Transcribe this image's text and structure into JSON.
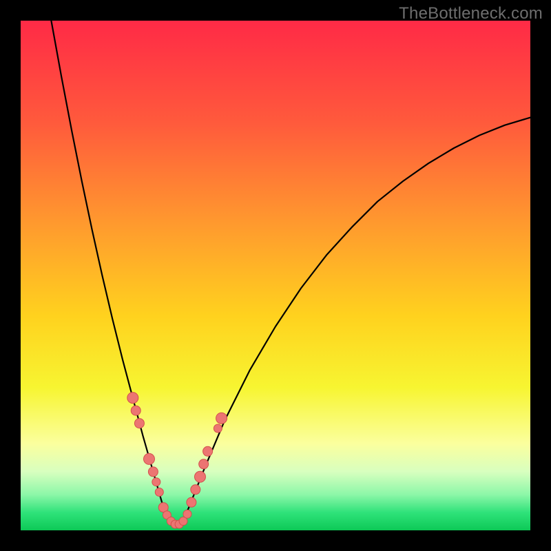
{
  "watermark": "TheBottleneck.com",
  "colors": {
    "frame": "#000000",
    "watermark_text": "#6e6e6e",
    "curve_stroke": "#000000",
    "dot_fill": "#ec7572",
    "dot_stroke": "#d34f4c",
    "gradient_stops": [
      {
        "offset": 0.0,
        "color": "#ff2a46"
      },
      {
        "offset": 0.2,
        "color": "#ff5a3c"
      },
      {
        "offset": 0.4,
        "color": "#ff9a2e"
      },
      {
        "offset": 0.58,
        "color": "#ffd21e"
      },
      {
        "offset": 0.72,
        "color": "#f7f531"
      },
      {
        "offset": 0.83,
        "color": "#fbff9e"
      },
      {
        "offset": 0.885,
        "color": "#d8ffbf"
      },
      {
        "offset": 0.93,
        "color": "#8cf7a8"
      },
      {
        "offset": 0.965,
        "color": "#2fe27a"
      },
      {
        "offset": 1.0,
        "color": "#0dc956"
      }
    ]
  },
  "chart_data": {
    "type": "line",
    "title": "",
    "xlabel": "",
    "ylabel": "",
    "xlim": [
      0,
      100
    ],
    "ylim": [
      0,
      100
    ],
    "grid": false,
    "legend": false,
    "series": [
      {
        "name": "left-branch",
        "x": [
          6.0,
          8.0,
          10.0,
          12.0,
          14.0,
          16.0,
          18.0,
          20.0,
          22.0,
          24.0,
          25.0,
          26.0,
          27.0,
          28.0
        ],
        "y": [
          100.0,
          89.0,
          78.5,
          68.5,
          59.0,
          50.0,
          41.5,
          33.5,
          26.0,
          18.5,
          15.0,
          11.5,
          8.0,
          4.5
        ]
      },
      {
        "name": "trough",
        "x": [
          28.0,
          29.0,
          30.0,
          31.0,
          32.0,
          33.0
        ],
        "y": [
          4.5,
          2.2,
          1.2,
          1.2,
          2.2,
          4.5
        ]
      },
      {
        "name": "right-branch",
        "x": [
          33.0,
          36.0,
          40.0,
          45.0,
          50.0,
          55.0,
          60.0,
          65.0,
          70.0,
          75.0,
          80.0,
          85.0,
          90.0,
          95.0,
          100.0
        ],
        "y": [
          4.5,
          12.0,
          21.5,
          31.5,
          40.0,
          47.5,
          54.0,
          59.5,
          64.5,
          68.5,
          72.0,
          75.0,
          77.5,
          79.5,
          81.0
        ]
      }
    ],
    "dots": {
      "name": "sample-points",
      "x": [
        22.0,
        22.6,
        23.3,
        25.2,
        26.0,
        26.6,
        27.2,
        28.0,
        28.7,
        29.5,
        30.3,
        31.1,
        31.9,
        32.7,
        33.5,
        34.3,
        35.2,
        35.9,
        36.7,
        38.7,
        39.4
      ],
      "y": [
        26.0,
        23.5,
        21.0,
        14.0,
        11.5,
        9.5,
        7.5,
        4.5,
        3.0,
        1.8,
        1.2,
        1.2,
        1.8,
        3.2,
        5.5,
        8.0,
        10.5,
        13.0,
        15.5,
        20.0,
        22.0
      ],
      "r": [
        8,
        7,
        7,
        8,
        7,
        6,
        6,
        7,
        6,
        6,
        6,
        6,
        6,
        6,
        7,
        7,
        8,
        7,
        7,
        6,
        8
      ]
    }
  }
}
